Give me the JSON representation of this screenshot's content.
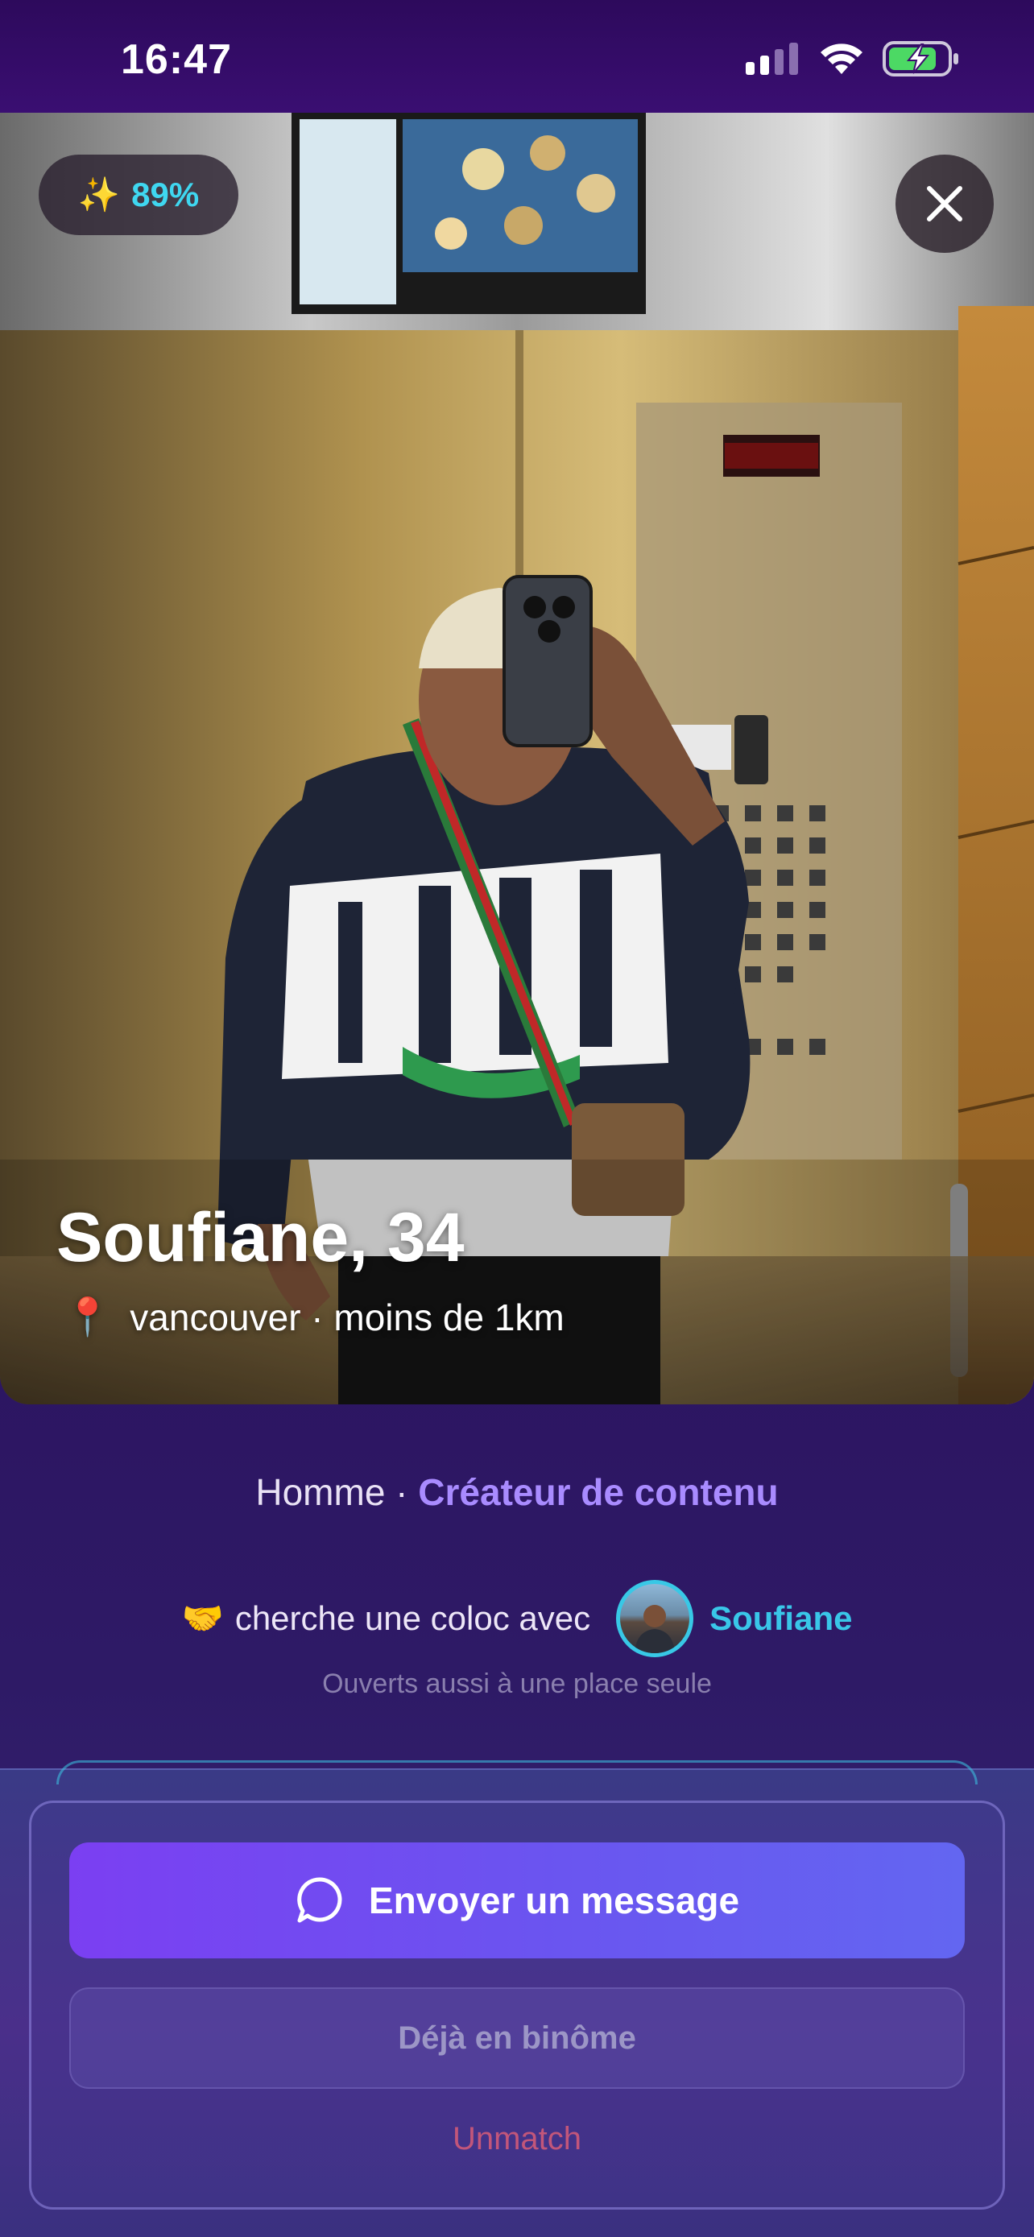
{
  "status_bar": {
    "time": "16:47",
    "icons": [
      "signal-icon",
      "wifi-icon",
      "battery-charging-icon"
    ],
    "battery_color": "#4cd964"
  },
  "photo": {
    "compatibility_emoji": "✨",
    "compatibility": "89%",
    "name_age": "Soufiane, 34",
    "location_emoji": "📍",
    "location": "vancouver · moins de 1km"
  },
  "info": {
    "gender": "Homme",
    "separator": " · ",
    "profession": "Créateur de contenu",
    "coloc_emoji": "🤝",
    "coloc_text": "cherche une coloc avec",
    "coloc_partner": "Soufiane",
    "coloc_note": "Ouverts aussi à une place seule"
  },
  "actions": {
    "message_label": "Envoyer un message",
    "binome_label": "Déjà en binôme",
    "unmatch_label": "Unmatch"
  },
  "colors": {
    "accent_purple": "#a98bff",
    "accent_cyan": "#39c6e8",
    "button_gradient_start": "#7b3ff2",
    "button_gradient_end": "#6366f1",
    "unmatch": "#c2567a"
  }
}
